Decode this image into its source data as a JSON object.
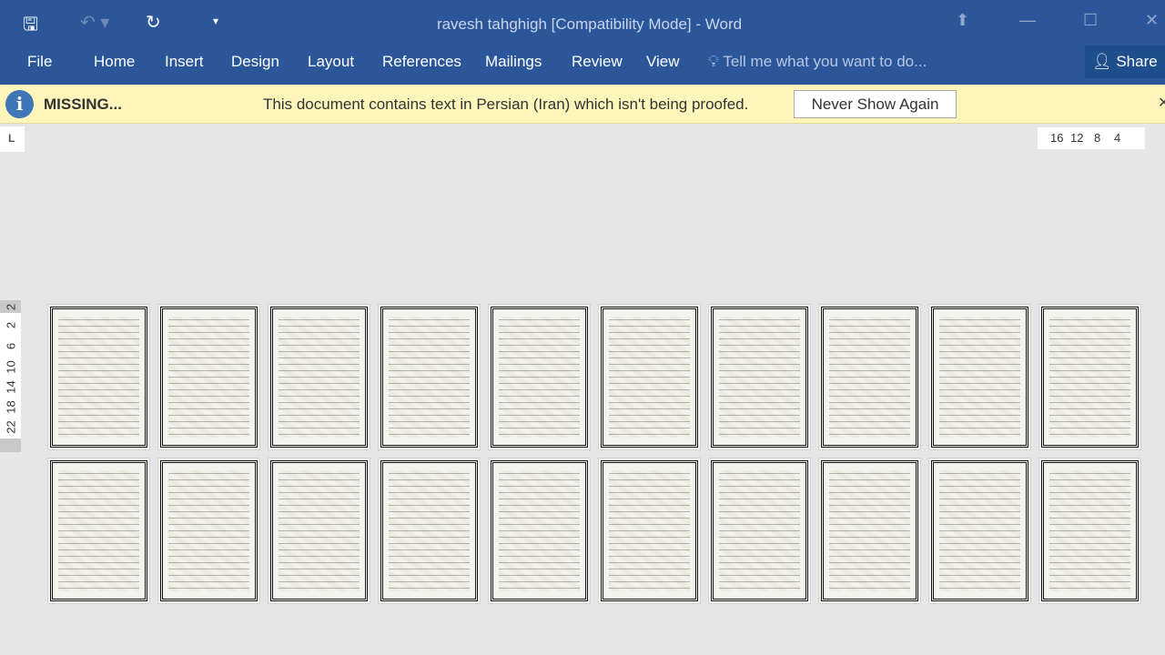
{
  "titlebar": {
    "title": "ravesh tahghigh [Compatibility Mode] - Word",
    "icons": [
      "save-icon",
      "undo-icon",
      "redo-icon",
      "customize-quick-access-icon"
    ]
  },
  "ribbon": {
    "tabs": [
      "File",
      "Home",
      "Insert",
      "Design",
      "Layout",
      "References",
      "Mailings",
      "Review",
      "View"
    ],
    "tell_me": "Tell me what you want to do...",
    "share": "Share"
  },
  "message_bar": {
    "title": "MISSING...",
    "text": "This document contains text in Persian (Iran) which isn't being proofed.",
    "button": "Never Show Again"
  },
  "ruler": {
    "horizontal": [
      "16",
      "12",
      "8",
      "4"
    ],
    "vertical": [
      "2",
      "2",
      "6",
      "10",
      "14",
      "18",
      "22"
    ]
  },
  "colors": {
    "accent": "#2b579a",
    "message_bar": "#fdf6bb"
  }
}
